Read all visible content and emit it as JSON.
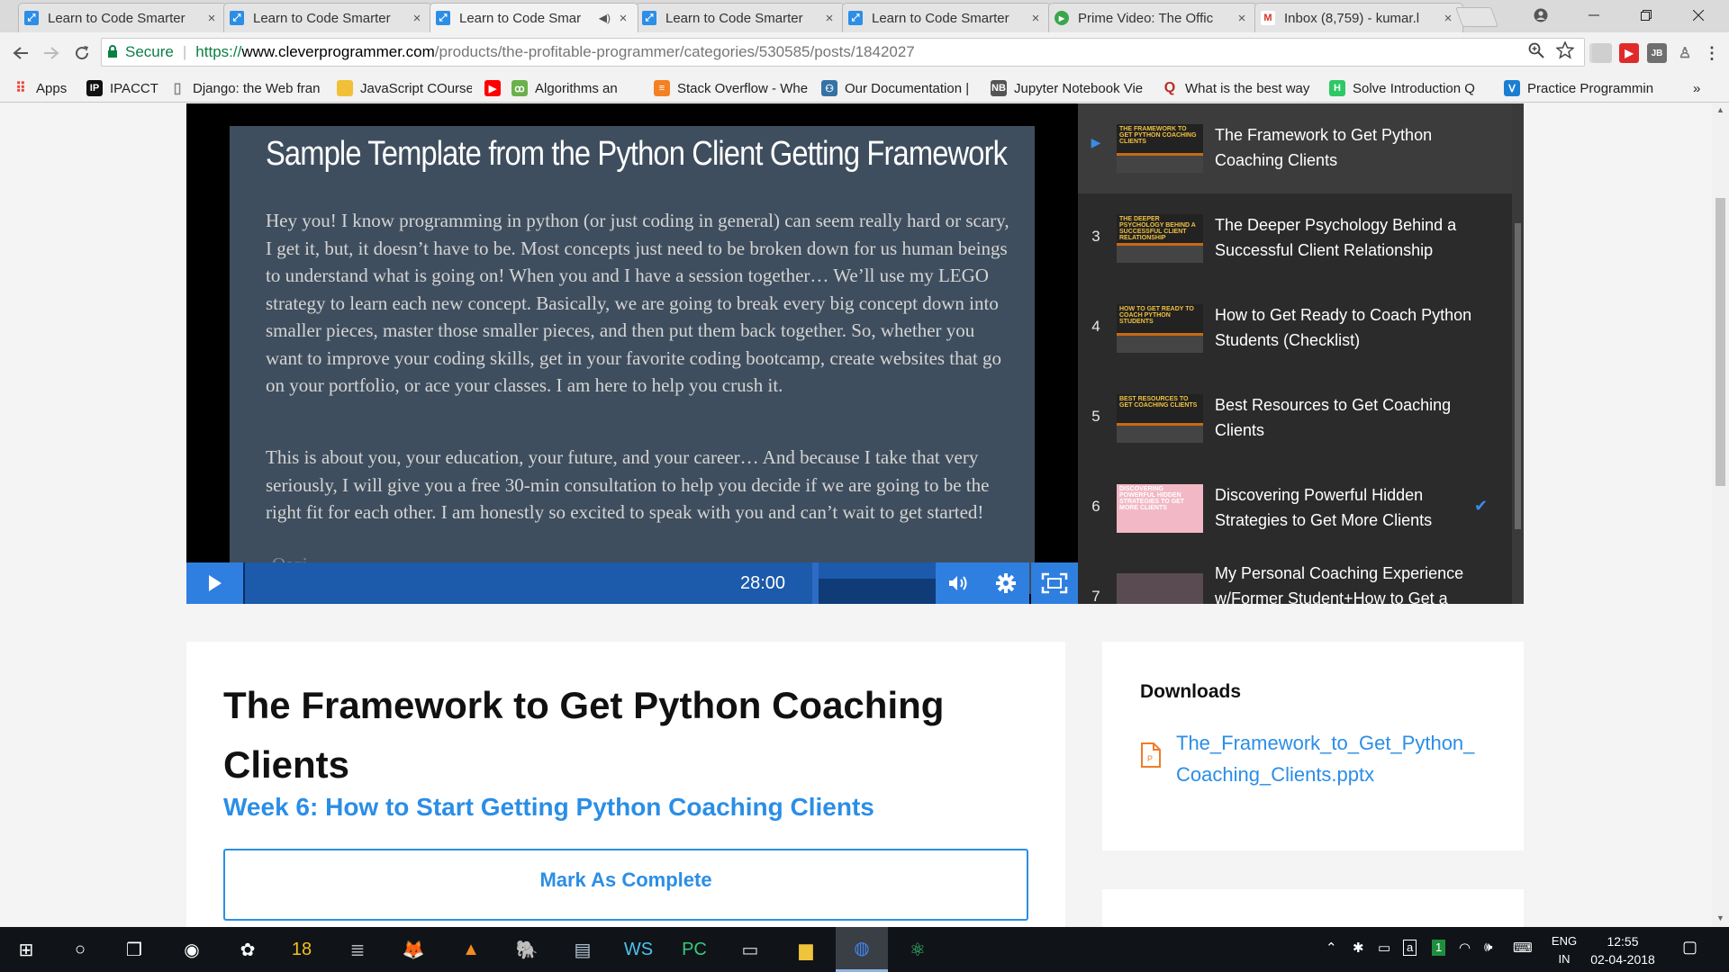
{
  "browser": {
    "tabs": [
      {
        "title": "Learn to Code Smarter",
        "favicon": "cp-icon",
        "color": "#2d8ee6",
        "audio": false,
        "active": false
      },
      {
        "title": "Learn to Code Smarter",
        "favicon": "cp-icon",
        "color": "#2d8ee6",
        "audio": false,
        "active": false
      },
      {
        "title": "Learn to Code Smar",
        "favicon": "cp-icon",
        "color": "#2d8ee6",
        "audio": true,
        "active": true
      },
      {
        "title": "Learn to Code Smarter",
        "favicon": "cp-icon",
        "color": "#2d8ee6",
        "audio": false,
        "active": false
      },
      {
        "title": "Learn to Code Smarter",
        "favicon": "cp-icon",
        "color": "#2d8ee6",
        "audio": false,
        "active": false
      },
      {
        "title": "Prime Video: The Offic",
        "favicon": "prime-video-icon",
        "color": "#3aa64b",
        "audio": false,
        "active": false
      },
      {
        "title": "Inbox (8,759) - kumar.l",
        "favicon": "gmail-icon",
        "color": "#d93025",
        "audio": false,
        "active": false
      }
    ],
    "tab_close_glyph": "×",
    "address": {
      "secure_label": "Secure",
      "scheme": "https://",
      "host": "www.cleverprogrammer.com",
      "path": "/products/the-profitable-programmer/categories/530585/posts/1842027"
    },
    "bookmarks": [
      {
        "label": "Apps",
        "icon": "apps-grid-icon",
        "color": "#e94235"
      },
      {
        "label": "IPACCT",
        "icon": "ip-icon",
        "color": "#111111"
      },
      {
        "label": "Django: the Web fran",
        "icon": "page-icon",
        "color": "#888888"
      },
      {
        "label": "JavaScript COurse",
        "icon": "folder-icon",
        "color": "#f2c037"
      },
      {
        "label": "",
        "icon": "youtube-icon",
        "color": "#ff0000"
      },
      {
        "label": "Algorithms an",
        "icon": "algo-icon",
        "color": "#6ab04c"
      },
      {
        "label": "Stack Overflow - Whe",
        "icon": "stackoverflow-icon",
        "color": "#f48024"
      },
      {
        "label": "Our Documentation |",
        "icon": "python-icon",
        "color": "#3572a5"
      },
      {
        "label": "Jupyter Notebook Vie",
        "icon": "nb-icon",
        "color": "#555555"
      },
      {
        "label": "What is the best way",
        "icon": "quora-icon",
        "color": "#b92b27"
      },
      {
        "label": "Solve Introduction Q",
        "icon": "hackerrank-icon",
        "color": "#2ec866"
      },
      {
        "label": "Practice Programmin",
        "icon": "practice-icon",
        "color": "#1b7fd1"
      }
    ],
    "bookmarks_overflow": "»"
  },
  "video": {
    "slide_title": "Sample Template from the Python Client Getting Framework",
    "slide_paragraph_1": "Hey you! I know programming in python (or just coding in general) can seem really hard or scary, I get it, but, it doesn’t have to be. Most concepts just need to be broken down for us human beings to understand what is going on! When you and I have a session together… We’ll use my LEGO strategy to learn each new concept. Basically, we are going to break every big concept down into smaller pieces, master those smaller pieces, and then put them back together. So, whether you want to improve your coding skills, get in your favorite coding bootcamp, create websites that go on your portfolio, or ace your classes. I am here to help you crush it.",
    "slide_paragraph_2": "This is about you, your education, your future, and your career… And because I take that very seriously, I will give you a free 30-min consultation to help you decide if we are going to be the right fit for each other. I am honestly so excited to speak with you and can’t wait to get started!",
    "slide_signature": "-Qazi",
    "timecode": "28:00",
    "played_fraction": 0.0,
    "accent_color": "#2f7fe0"
  },
  "playlist": {
    "items": [
      {
        "number": "",
        "title_line1": "The Framework to Get Python",
        "title_line2": "Coaching Clients",
        "thumb_text": "THE FRAMEWORK TO GET PYTHON COACHING CLIENTS",
        "current": true,
        "completed": false,
        "thumb": "dark"
      },
      {
        "number": "3",
        "title_line1": "The Deeper Psychology Behind a",
        "title_line2": "Successful Client Relationship",
        "thumb_text": "THE DEEPER PSYCHOLOGY BEHIND A SUCCESSFUL CLIENT RELATIONSHIP",
        "current": false,
        "completed": false,
        "thumb": "dark"
      },
      {
        "number": "4",
        "title_line1": "How to Get Ready to Coach Python",
        "title_line2": "Students (Checklist)",
        "thumb_text": "HOW TO GET READY TO COACH PYTHON STUDENTS",
        "current": false,
        "completed": false,
        "thumb": "dark"
      },
      {
        "number": "5",
        "title_line1": "Best Resources to Get Coaching",
        "title_line2": "Clients",
        "thumb_text": "BEST RESOURCES TO GET COACHING CLIENTS",
        "current": false,
        "completed": false,
        "thumb": "dark"
      },
      {
        "number": "6",
        "title_line1": "Discovering Powerful Hidden",
        "title_line2": "Strategies to Get More Clients",
        "thumb_text": "DISCOVERING POWERFUL HIDDEN STRATEGIES TO GET MORE CLIENTS",
        "current": false,
        "completed": true,
        "thumb": "pink"
      },
      {
        "number": "7",
        "title_line1": "My Personal Coaching Experience",
        "title_line2": "w/Former Student+How to Get a",
        "thumb_text": "",
        "current": false,
        "completed": false,
        "thumb": "photo"
      }
    ]
  },
  "lesson": {
    "title": "The Framework to Get Python Coaching Clients",
    "week_link": "Week 6: How to Start Getting Python Coaching Clients",
    "mark_complete_label": "Mark As Complete"
  },
  "downloads": {
    "heading": "Downloads",
    "file_line1": "The_Framework_to_Get_Python_",
    "file_line2": "Coaching_Clients.pptx"
  },
  "taskbar": {
    "apps": [
      "windows-start-icon",
      "cortana-icon",
      "task-view-icon",
      "media-player-icon",
      "settings-app-icon",
      "18-app-icon",
      "database-icon",
      "fox-icon",
      "vlc-icon",
      "postgres-icon",
      "file-editor-icon",
      "webstorm-icon",
      "pycharm-icon",
      "terminal-icon",
      "file-explorer-icon",
      "chrome-icon",
      "atom-icon"
    ],
    "lang_line1": "ENG",
    "lang_line2": "IN",
    "time": "12:55",
    "date": "02-04-2018",
    "badge": "1"
  }
}
